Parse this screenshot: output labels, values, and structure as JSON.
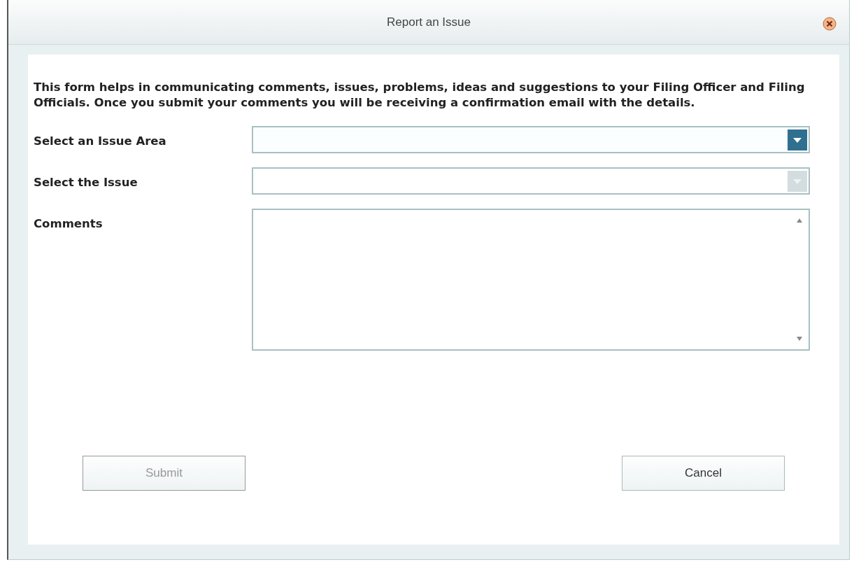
{
  "window": {
    "title": "Report an Issue"
  },
  "intro": "This form helps in communicating comments, issues, problems, ideas and suggestions to your Filing Officer and Filing Officials. Once you submit your comments you will be receiving a confirmation email with the details.",
  "fields": [
    {
      "label": "Select an Issue Area",
      "kind": "select",
      "disabled": false
    },
    {
      "label": "Select the Issue",
      "kind": "select",
      "disabled": true
    },
    {
      "label": "Comments",
      "kind": "textarea",
      "disabled": false
    }
  ],
  "buttons": [
    {
      "label": "Submit",
      "disabled": true
    },
    {
      "label": "Cancel",
      "disabled": false
    }
  ]
}
